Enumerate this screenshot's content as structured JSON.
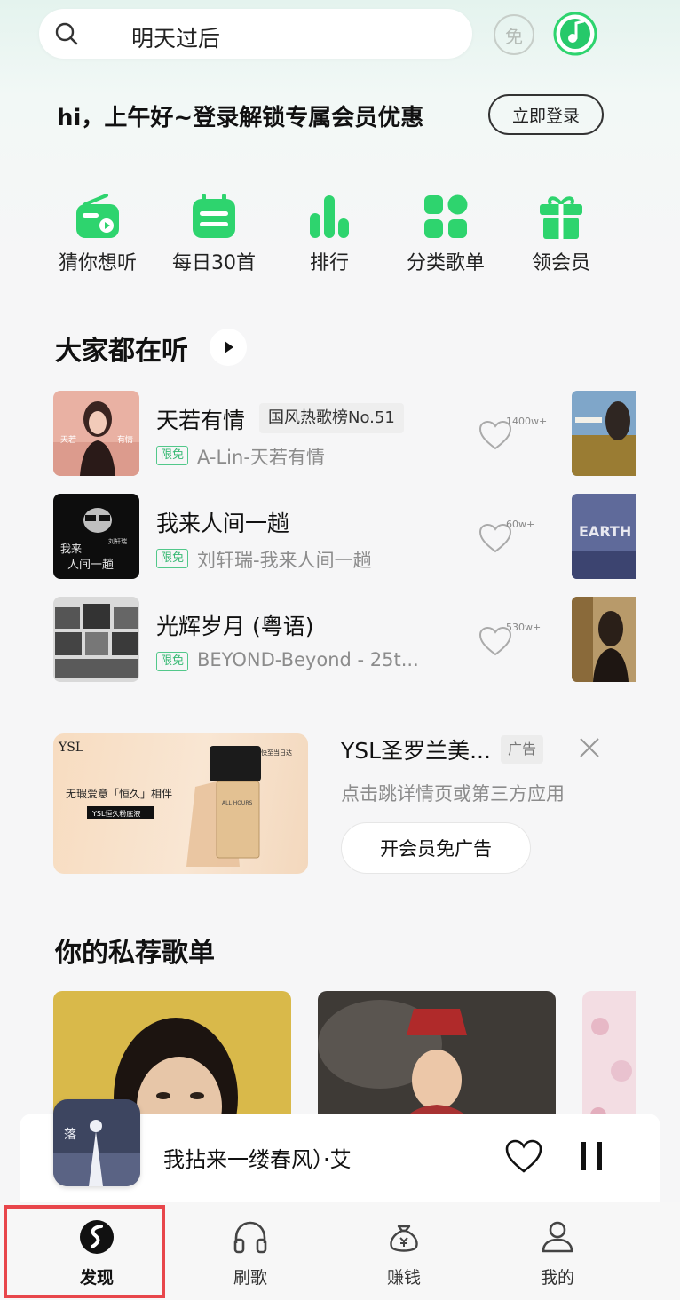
{
  "search": {
    "placeholder_text": "明天过后"
  },
  "header": {
    "free_badge": "免",
    "music_icon": "music-note-icon"
  },
  "greeting": {
    "text": "hi，上午好~登录解锁专属会员优惠",
    "login_button": "立即登录"
  },
  "quick_entries": [
    {
      "label": "猜你想听",
      "icon": "radio-icon"
    },
    {
      "label": "每日30首",
      "icon": "calendar-icon"
    },
    {
      "label": "排行",
      "icon": "ranking-bars-icon"
    },
    {
      "label": "分类歌单",
      "icon": "category-grid-icon"
    },
    {
      "label": "领会员",
      "icon": "gift-icon"
    }
  ],
  "popular": {
    "title": "大家都在听",
    "songs": [
      {
        "title": "天若有情",
        "tag": "国风热歌榜No.51",
        "free_tag": "限免",
        "artist": "A-Lin-天若有情",
        "likes": "1400w+"
      },
      {
        "title": "我来人间一趟",
        "tag": "",
        "free_tag": "限免",
        "artist": "刘轩瑞-我来人间一趟",
        "likes": "60w+"
      },
      {
        "title": "光辉岁月 (粤语)",
        "tag": "",
        "free_tag": "限免",
        "artist": "BEYOND-Beyond - 25t...",
        "likes": "530w+"
      }
    ]
  },
  "ad": {
    "title": "YSL圣罗兰美...",
    "tag": "广告",
    "description": "点击跳详情页或第三方应用",
    "vip_button": "开会员免广告",
    "image_text_1": "无瑕爱意「恒久」相伴",
    "image_text_2": "YSL恒久粉底液",
    "image_text_3": "快至当日达"
  },
  "private_playlists": {
    "title": "你的私荐歌单"
  },
  "mini_player": {
    "title": "我拈来一缕春风）·艾"
  },
  "bottom_nav": [
    {
      "label": "发现",
      "icon": "discover-icon",
      "active": true
    },
    {
      "label": "刷歌",
      "icon": "headphones-icon",
      "active": false
    },
    {
      "label": "赚钱",
      "icon": "money-bag-icon",
      "active": false
    },
    {
      "label": "我的",
      "icon": "person-icon",
      "active": false
    }
  ],
  "colors": {
    "accent": "#2ed46e",
    "highlight": "#e8464b"
  }
}
